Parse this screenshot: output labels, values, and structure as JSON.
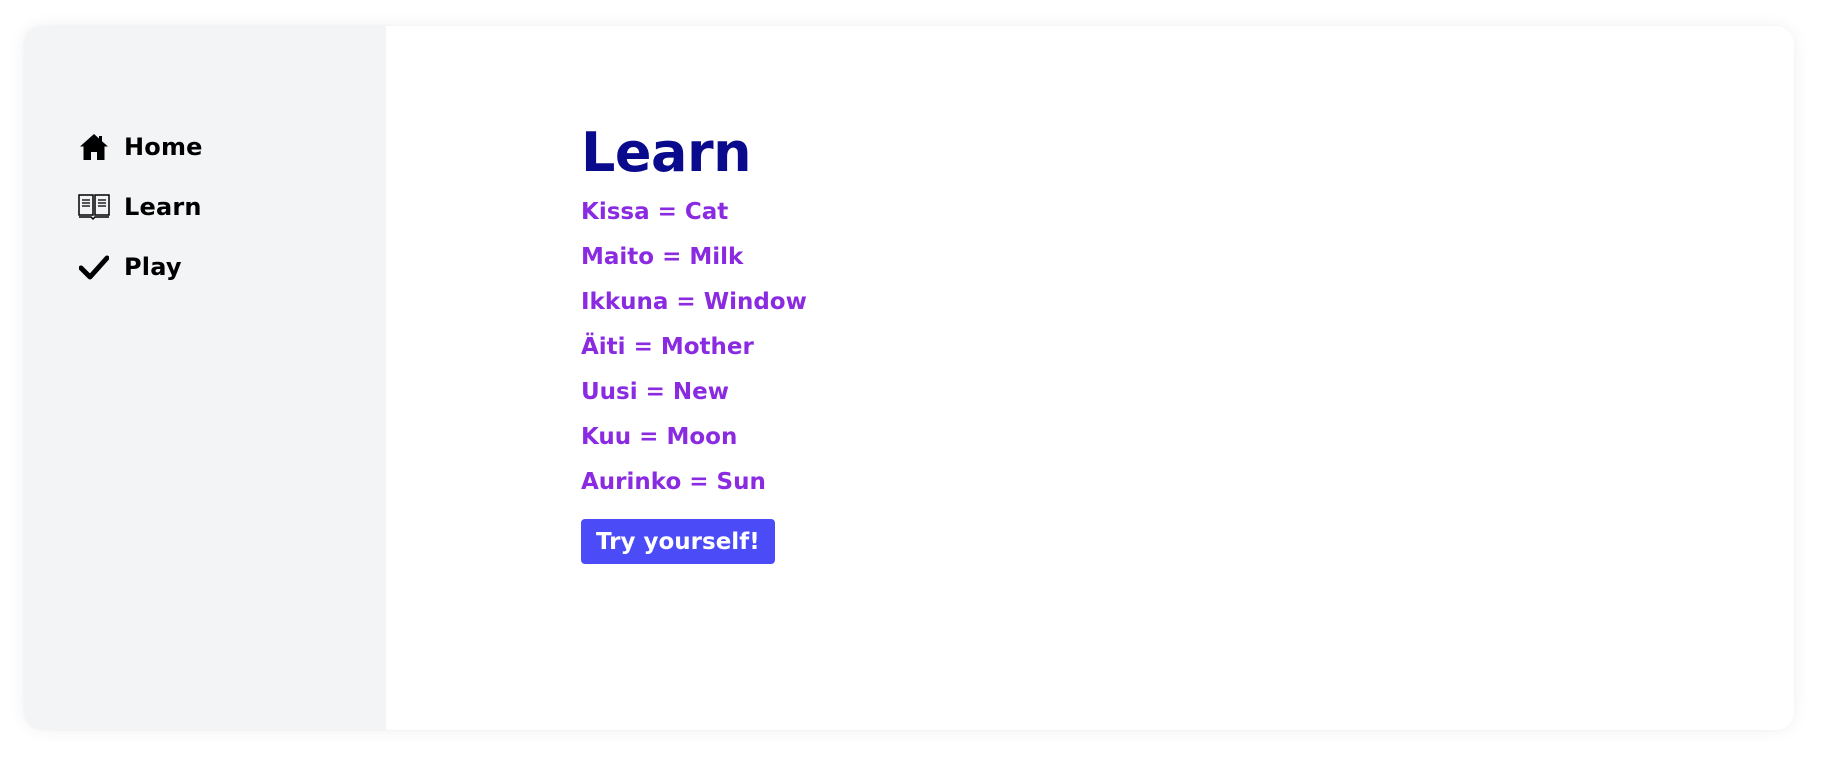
{
  "colors": {
    "sidebar_bg": "#f3f4f6",
    "title": "#0a0a8c",
    "word": "#8a2be2",
    "button_bg": "#4b4cf7",
    "button_text": "#ffffff"
  },
  "sidebar": {
    "items": [
      {
        "label": "Home",
        "icon": "home-icon"
      },
      {
        "label": "Learn",
        "icon": "book-icon"
      },
      {
        "label": "Play",
        "icon": "checkmark-icon"
      }
    ]
  },
  "main": {
    "title": "Learn",
    "words": [
      "Kissa = Cat",
      "Maito = Milk",
      "Ikkuna = Window",
      "Äiti = Mother",
      "Uusi = New",
      "Kuu = Moon",
      "Aurinko = Sun"
    ],
    "button_label": "Try yourself!"
  }
}
